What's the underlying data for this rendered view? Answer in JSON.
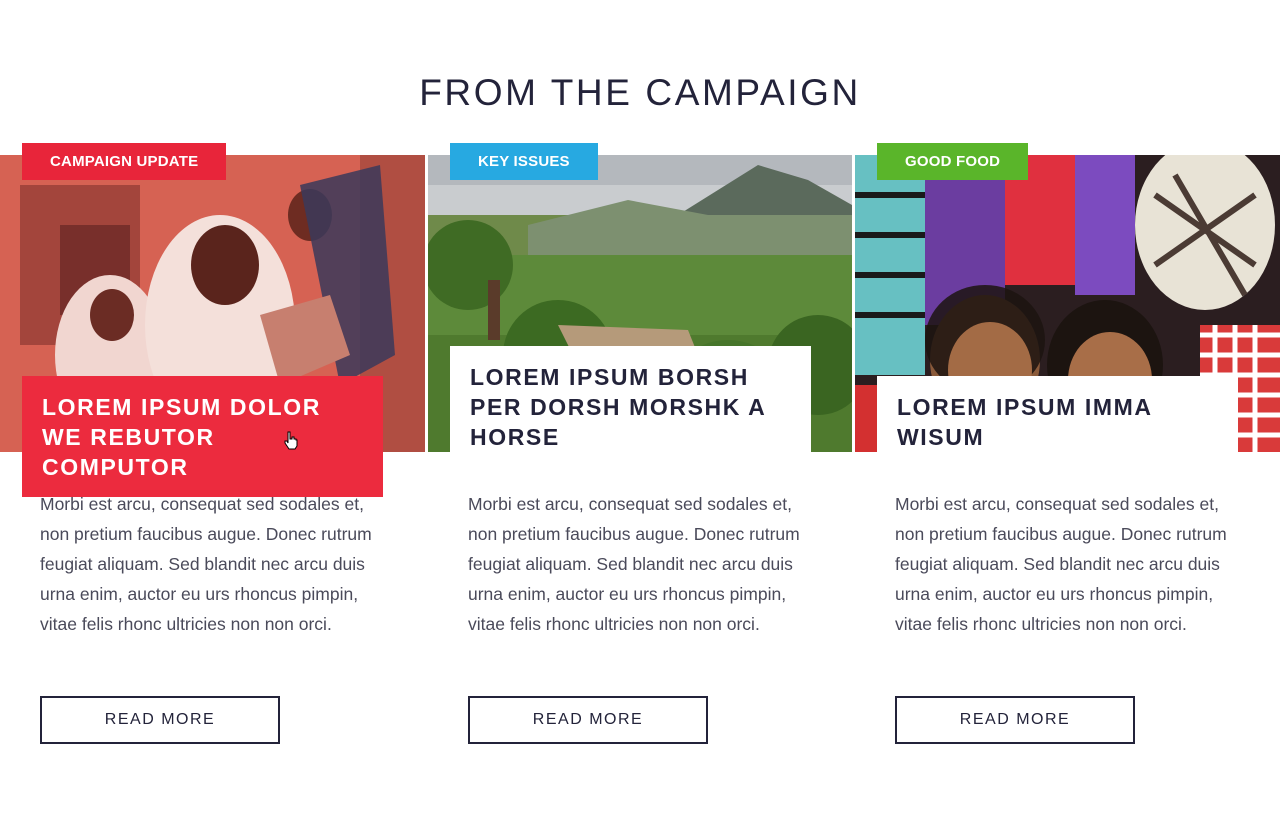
{
  "section": {
    "title": "FROM THE CAMPAIGN"
  },
  "cards": [
    {
      "tag": "CAMPAIGN UPDATE",
      "headline": "LOREM IPSUM DOLOR WE REBUTOR COMPUTOR",
      "body": "Morbi est arcu, consequat sed sodales et, non pretium faucibus augue. Donec rutrum feugiat aliquam. Sed blandit nec arcu duis urna enim, auctor eu urs rhoncus pimpin, vitae felis rhonc ultricies non non orci.",
      "button": "READ MORE",
      "image": "mothers-and-baby-photo"
    },
    {
      "tag": "KEY ISSUES",
      "headline": "LOREM IPSUM BORSH PER DORSH MORSHK A HORSE",
      "body": "Morbi est arcu, consequat sed sodales et, non pretium faucibus augue. Donec rutrum feugiat aliquam. Sed blandit nec arcu duis urna enim, auctor eu urs rhoncus pimpin, vitae felis rhonc ultricies non non orci.",
      "button": "READ MORE",
      "image": "green-valley-landscape-photo"
    },
    {
      "tag": "GOOD FOOD",
      "headline": "LOREM IPSUM IMMA WISUM",
      "body": "Morbi est arcu, consequat sed sodales et, non pretium faucibus augue. Donec rutrum feugiat aliquam. Sed blandit nec arcu duis urna enim, auctor eu urs rhoncus pimpin, vitae felis rhonc ultricies non non orci.",
      "button": "READ MORE",
      "image": "smiling-girls-with-bags-photo"
    }
  ],
  "colors": {
    "campaign_update": "#e8253a",
    "key_issues": "#27a9e1",
    "good_food": "#5ab52a",
    "text_dark": "#23233a"
  }
}
